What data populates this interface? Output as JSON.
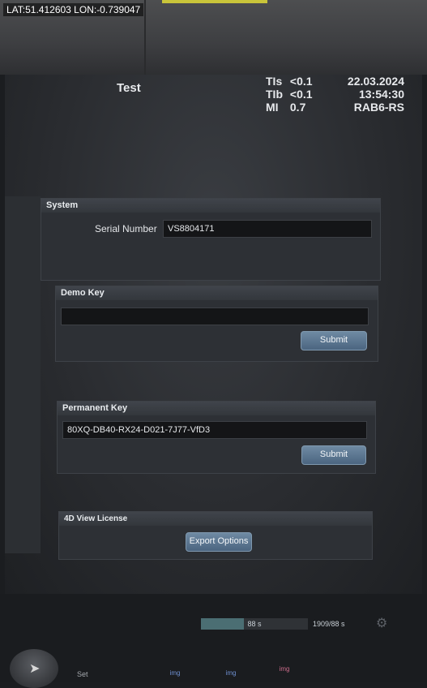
{
  "overlay": {
    "geo_stamp": "LAT:51.412603 LON:-0.739047"
  },
  "header": {
    "patient_name": "Test",
    "tis_label": "TIs",
    "tis_value": "<0.1",
    "tib_label": "TIb",
    "tib_value": "<0.1",
    "mi_label": "MI",
    "mi_value": "0.7",
    "date": "22.03.2024",
    "time": "13:54:30",
    "probe": "RAB6-RS"
  },
  "system_panel": {
    "title": "System",
    "serial_label": "Serial Number",
    "serial_value": "VS8804171"
  },
  "demo_key_panel": {
    "title": "Demo Key",
    "key_value": "",
    "submit_label": "Submit"
  },
  "permanent_key_panel": {
    "title": "Permanent Key",
    "key_value": "80XQ-DB40-RX24-D021-7J77-VfD3",
    "submit_label": "Submit"
  },
  "view_license_panel": {
    "title": "4D View License",
    "export_label": "Export Options"
  },
  "status_bar": {
    "progress_text": "88 s",
    "progress_fraction": 0.4,
    "counter_text": "1909/88 s",
    "gear_icon": "gear-icon"
  },
  "control_panel": {
    "set_label": "Set",
    "img_label_1": "img",
    "img_label_2": "img",
    "img_label_3": "img"
  }
}
